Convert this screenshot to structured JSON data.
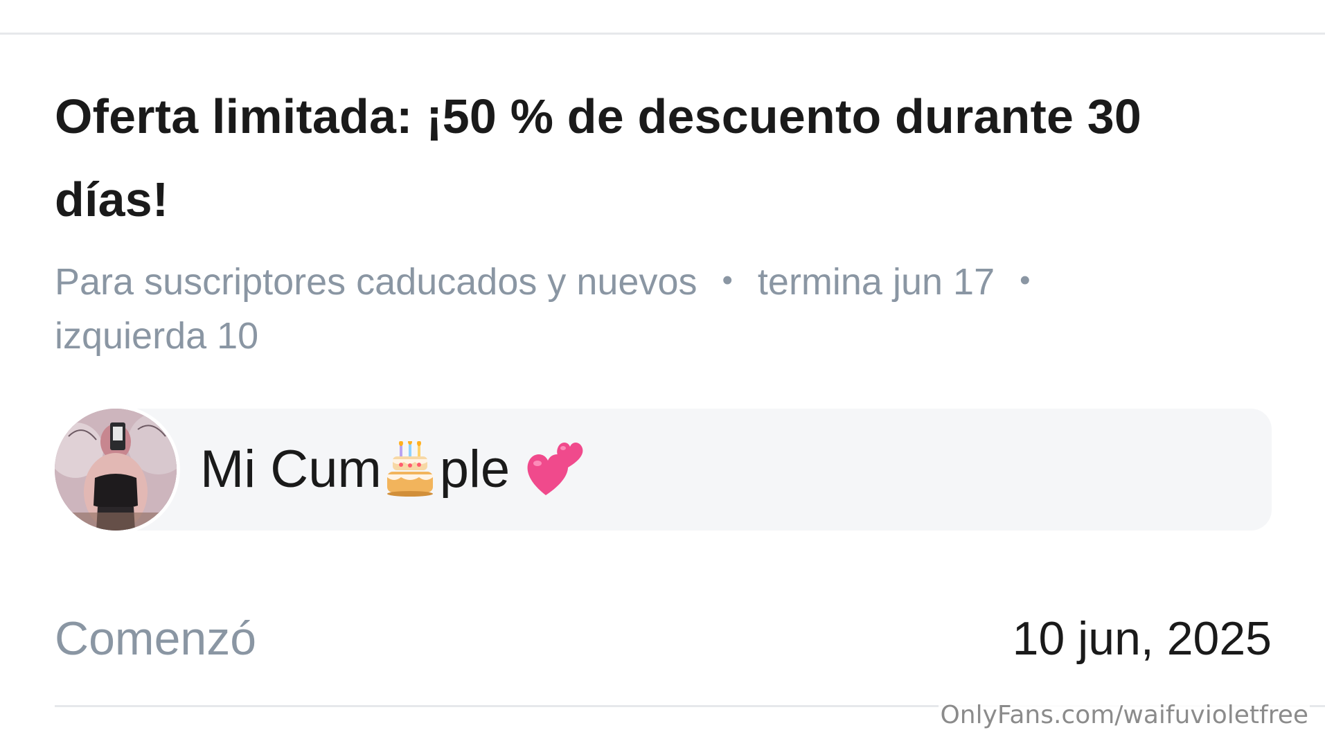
{
  "offer": {
    "title": "Oferta limitada: ¡50 % de descuento durante 30 días!",
    "audience": "Para suscriptores caducados y nuevos",
    "separator": "•",
    "ends": "termina jun 17",
    "remaining": "izquierda 10"
  },
  "message": {
    "text_before": "Mi Cum",
    "emoji_middle": "birthday-cake-emoji",
    "text_after": "ple",
    "emoji_end": "two-hearts-emoji"
  },
  "start": {
    "label": "Comenzó",
    "date": "10 jun, 2025"
  },
  "watermark": "OnlyFans.com/waifuvioletfree",
  "colors": {
    "text_primary": "#1a1a1a",
    "text_secondary": "#8a96a3",
    "bubble_background": "#f5f6f8",
    "divider": "#e6e8eb",
    "heart_pink": "#f04a8c"
  }
}
